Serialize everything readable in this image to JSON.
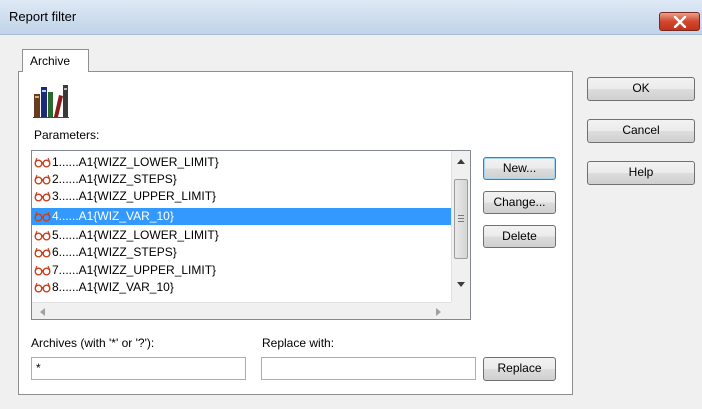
{
  "window": {
    "title": "Report filter"
  },
  "tabs": [
    {
      "label": "Archive"
    }
  ],
  "parameters": {
    "label": "Parameters:",
    "items": [
      {
        "text": "1......A1{WIZZ_LOWER_LIMIT}",
        "selected": false
      },
      {
        "text": "2......A1{WIZZ_STEPS}",
        "selected": false
      },
      {
        "text": "3......A1{WIZZ_UPPER_LIMIT}",
        "selected": false
      },
      {
        "text": "4......A1{WIZ_VAR_10}",
        "selected": true
      },
      {
        "text": "5......A1{WIZZ_LOWER_LIMIT}",
        "selected": false
      },
      {
        "text": "6......A1{WIZZ_STEPS}",
        "selected": false
      },
      {
        "text": "7......A1{WIZZ_UPPER_LIMIT}",
        "selected": false
      },
      {
        "text": "8......A1{WIZ_VAR_10}",
        "selected": false
      }
    ]
  },
  "list_buttons": {
    "new": "New...",
    "change": "Change...",
    "delete": "Delete"
  },
  "dialog_buttons": {
    "ok": "OK",
    "cancel": "Cancel",
    "help": "Help"
  },
  "archives": {
    "label": "Archives (with '*' or '?'):",
    "value": "*"
  },
  "replace": {
    "label": "Replace with:",
    "value": "",
    "button": "Replace"
  },
  "colors": {
    "selection": "#3399ff",
    "close": "#c7432b"
  }
}
